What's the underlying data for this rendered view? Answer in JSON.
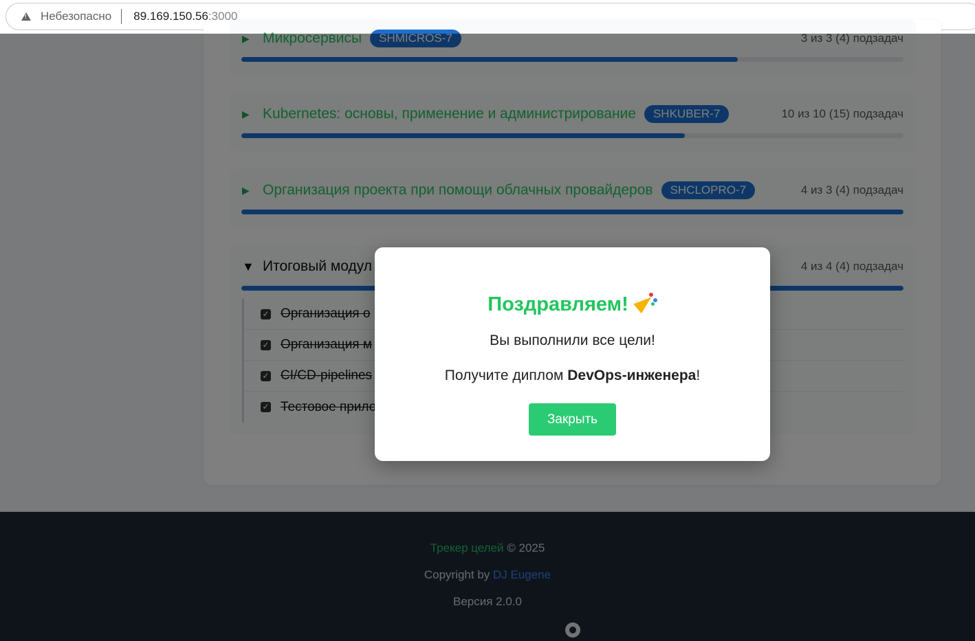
{
  "browser": {
    "security_label": "Небезопасно",
    "url_host": "89.169.150.56",
    "url_port": ":3000"
  },
  "modules": [
    {
      "title": "Микросервисы",
      "badge": "SHMICROS-7",
      "count": "3 из 3 (4) подзадач",
      "progress": 0.75
    },
    {
      "title": "Kubernetes: основы, применение и администрирование",
      "badge": "SHKUBER-7",
      "count": "10 из 10 (15) подзадач",
      "progress": 0.67
    },
    {
      "title": "Организация проекта при помощи облачных провайдеров",
      "badge": "SHCLOPRO-7",
      "count": "4 из 3 (4) подзадач",
      "progress": 1.0
    },
    {
      "title": "Итоговый модул",
      "count": "4 из 4 (4) подзадач",
      "progress": 1.0,
      "subtasks": [
        "Организация о",
        "Организация м",
        "CI/CD-pipelines",
        "Тестовое прило"
      ]
    }
  ],
  "footer": {
    "app_name": "Трекер целей",
    "year": " © 2025",
    "copyright_prefix": "Copyright by ",
    "author": "DJ Eugene",
    "version": "Версия 2.0.0",
    "github_icon": "github-icon"
  },
  "modal": {
    "title": "Поздравляем!",
    "emoji_icon": "party-popper-icon",
    "line1": "Вы выполнили все цели!",
    "line2_prefix": "Получите диплом ",
    "line2_bold": "DevOps-инженера",
    "line2_suffix": "!",
    "close_label": "Закрыть"
  },
  "colors": {
    "accent_green": "#22c55e",
    "badge_blue": "#1d6fd1",
    "footer_bg": "#1f2937"
  }
}
